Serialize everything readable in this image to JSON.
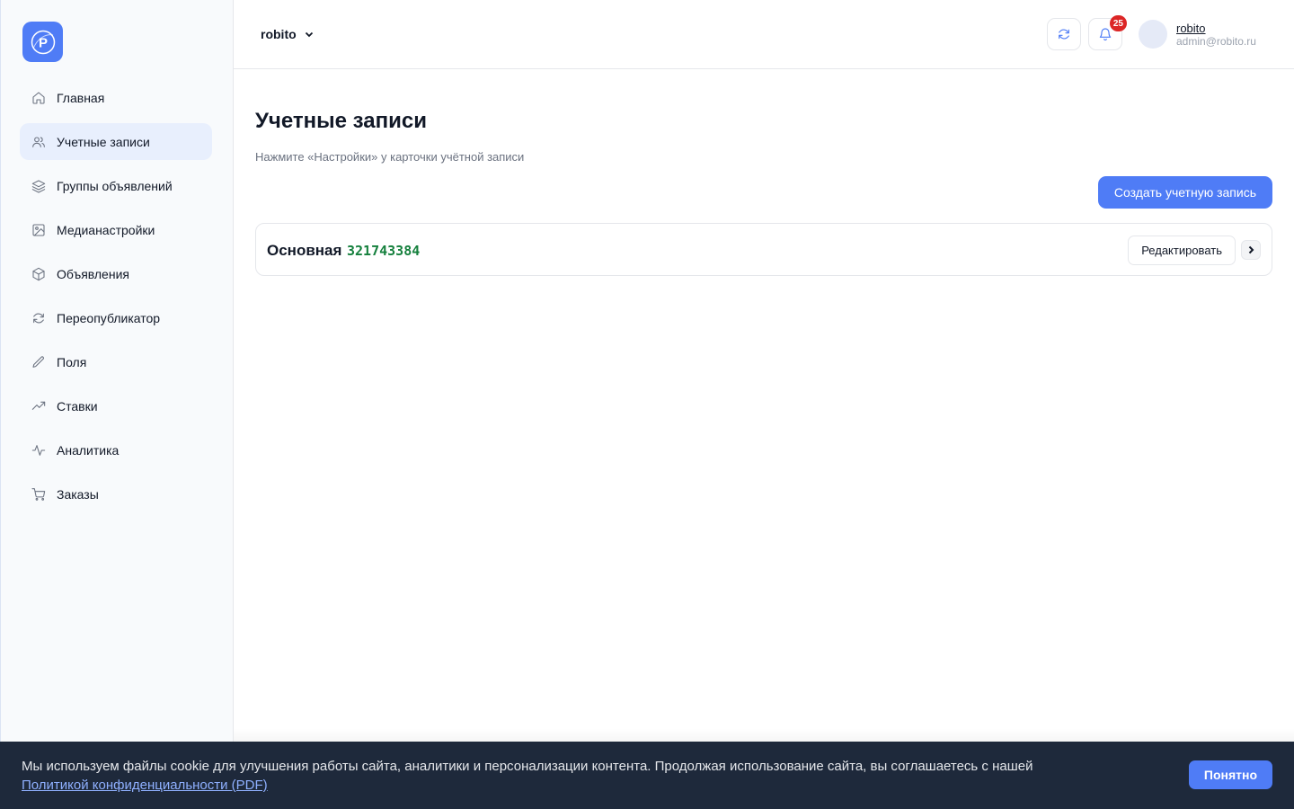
{
  "app": {
    "logo_letter": "P",
    "brand_color": "#4f7cf6"
  },
  "sidebar": {
    "items": [
      {
        "label": "Главная",
        "icon": "home-icon",
        "active": false
      },
      {
        "label": "Учетные записи",
        "icon": "users-icon",
        "active": true
      },
      {
        "label": "Группы объявлений",
        "icon": "layers-icon",
        "active": false
      },
      {
        "label": "Медианастройки",
        "icon": "image-icon",
        "active": false
      },
      {
        "label": "Объявления",
        "icon": "box-icon",
        "active": false
      },
      {
        "label": "Переопубликатор",
        "icon": "refresh-icon",
        "active": false
      },
      {
        "label": "Поля",
        "icon": "pencil-icon",
        "active": false
      },
      {
        "label": "Ставки",
        "icon": "trending-up-icon",
        "active": false
      },
      {
        "label": "Аналитика",
        "icon": "activity-icon",
        "active": false
      },
      {
        "label": "Заказы",
        "icon": "cart-icon",
        "active": false
      }
    ]
  },
  "header": {
    "workspace": "robito",
    "notifications_count": "25",
    "user_name": "robito",
    "user_email": "admin@robito.ru"
  },
  "main": {
    "title": "Учетные записи",
    "hint": "Нажмите «Настройки» у карточки учётной записи",
    "create_label": "Создать учетную запись",
    "accounts": [
      {
        "name": "Основная",
        "id": "321743384",
        "edit_label": "Редактировать"
      }
    ]
  },
  "cookie": {
    "text": "Мы используем файлы cookie для улучшения работы сайта, аналитики и персонализации контента. Продолжая использование сайта, вы соглашаетесь с нашей ",
    "link": "Политикой конфиденциальности (PDF)",
    "accept_label": "Понятно"
  },
  "colors": {
    "accent": "#4f7cf6",
    "id_green": "#15803d",
    "badge_red": "#dc2626",
    "cookie_bg": "#1e293b"
  }
}
